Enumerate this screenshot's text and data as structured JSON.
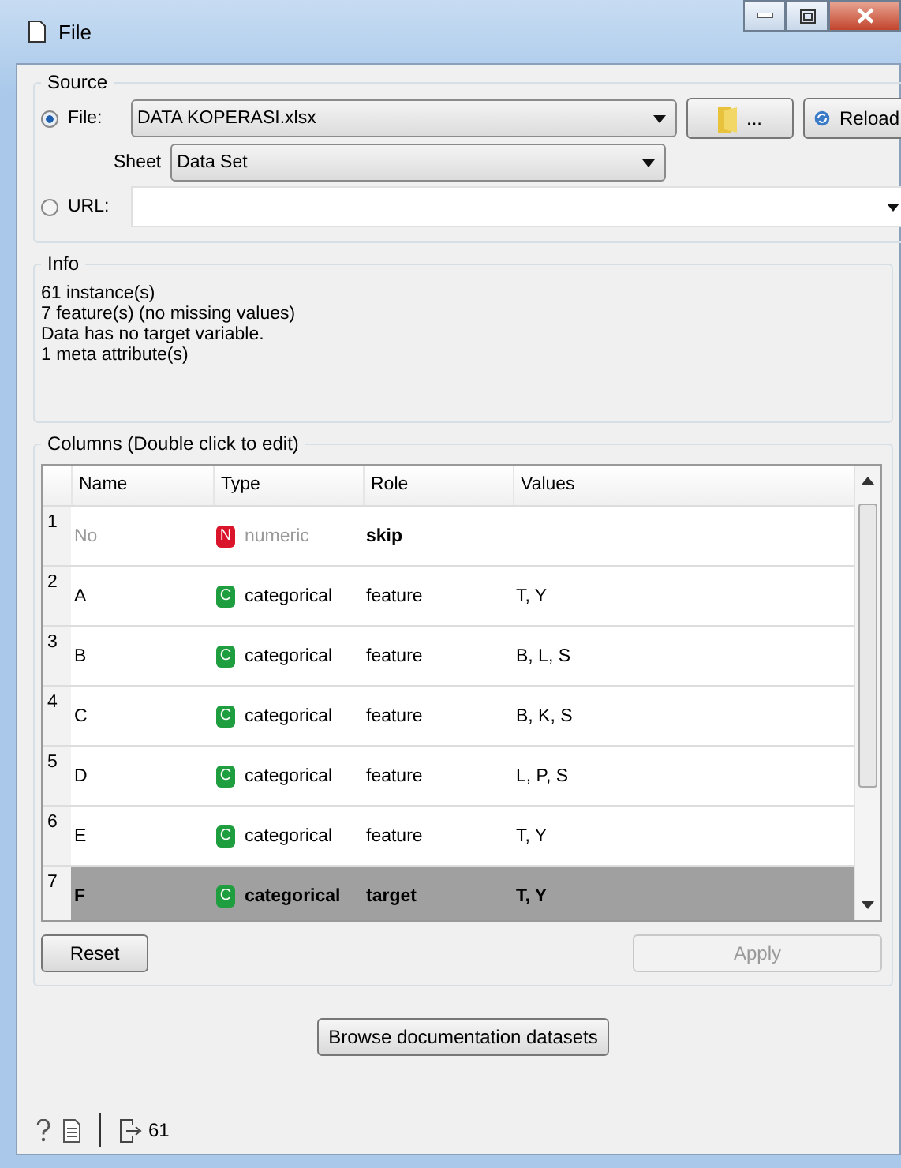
{
  "window": {
    "title": "File"
  },
  "source": {
    "title": "Source",
    "file": {
      "label": "File:",
      "selected": true,
      "value": "DATA KOPERASI.xlsx"
    },
    "browse_button": "...",
    "reload_button": "Reload",
    "sheet": {
      "label": "Sheet",
      "value": "Data Set"
    },
    "url": {
      "label": "URL:",
      "selected": false
    }
  },
  "info": {
    "title": "Info",
    "lines": [
      "61 instance(s)",
      "7 feature(s) (no missing values)",
      "Data has no target variable.",
      "1 meta attribute(s)"
    ]
  },
  "columns": {
    "title": "Columns (Double click to edit)",
    "headers": [
      "Name",
      "Type",
      "Role",
      "Values"
    ],
    "rows": [
      {
        "index": "1",
        "name": "No",
        "type_badge": "N",
        "color": "#d9142b",
        "type": "numeric",
        "role": "skip",
        "values": "",
        "disabled": true,
        "selected": false
      },
      {
        "index": "2",
        "name": "A",
        "type_badge": "C",
        "color": "#1e9e3e",
        "type": "categorical",
        "role": "feature",
        "values": "T, Y",
        "disabled": false,
        "selected": false
      },
      {
        "index": "3",
        "name": "B",
        "type_badge": "C",
        "color": "#1e9e3e",
        "type": "categorical",
        "role": "feature",
        "values": "B, L, S",
        "disabled": false,
        "selected": false
      },
      {
        "index": "4",
        "name": "C",
        "type_badge": "C",
        "color": "#1e9e3e",
        "type": "categorical",
        "role": "feature",
        "values": "B, K, S",
        "disabled": false,
        "selected": false
      },
      {
        "index": "5",
        "name": "D",
        "type_badge": "C",
        "color": "#1e9e3e",
        "type": "categorical",
        "role": "feature",
        "values": "L, P, S",
        "disabled": false,
        "selected": false
      },
      {
        "index": "6",
        "name": "E",
        "type_badge": "C",
        "color": "#1e9e3e",
        "type": "categorical",
        "role": "feature",
        "values": "T, Y",
        "disabled": false,
        "selected": false
      },
      {
        "index": "7",
        "name": "F",
        "type_badge": "C",
        "color": "#1e9e3e",
        "type": "categorical",
        "role": "target",
        "values": "T, Y",
        "disabled": false,
        "selected": true
      }
    ],
    "reset_button": "Reset",
    "apply_button": {
      "label": "Apply",
      "disabled": true
    }
  },
  "browse_docs_button": "Browse documentation datasets",
  "status_bar": {
    "output_count": "61"
  }
}
